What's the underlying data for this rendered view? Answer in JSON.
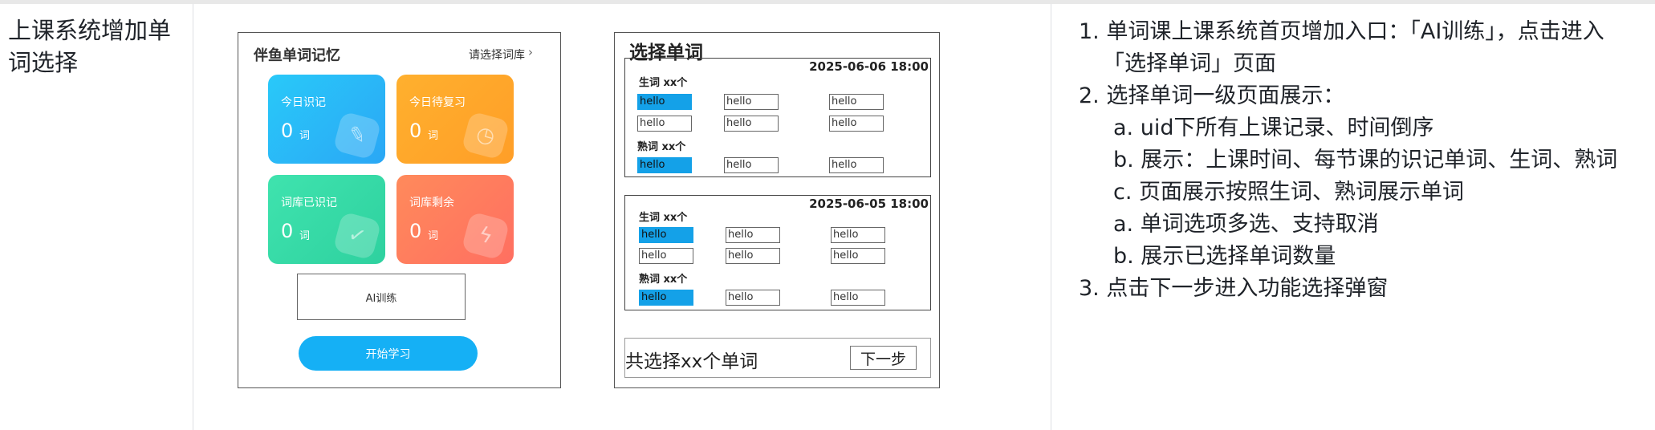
{
  "row_title": "上课系统增加单词选择",
  "mock_home": {
    "title": "伴鱼单词记忆",
    "select_lib": "请选择词库",
    "chevron": "›",
    "cards": [
      {
        "label": "今日识记",
        "value": "0",
        "unit": "词",
        "icon": "pencil-icon",
        "glyph": "✎"
      },
      {
        "label": "今日待复习",
        "value": "0",
        "unit": "词",
        "icon": "clock-icon",
        "glyph": "◷"
      },
      {
        "label": "词库已识记",
        "value": "0",
        "unit": "词",
        "icon": "check-icon",
        "glyph": "✓"
      },
      {
        "label": "词库剩余",
        "value": "0",
        "unit": "词",
        "icon": "bolt-icon",
        "glyph": "ϟ"
      }
    ],
    "ai_button": "AI训练",
    "start_button": "开始学习"
  },
  "mock_select": {
    "title": "选择单词",
    "groups": [
      {
        "date": "2025-06-06  18:00",
        "new_label": "生词  xx个",
        "known_label": "熟词  xx个",
        "new_rows": [
          [
            "hello",
            "hello",
            "hello"
          ],
          [
            "hello",
            "hello",
            "hello"
          ]
        ],
        "known_rows": [
          [
            "hello",
            "hello",
            "hello"
          ]
        ]
      },
      {
        "date": "2025-06-05  18:00",
        "new_label": "生词  xx个",
        "known_label": "熟词  xx个",
        "new_rows": [
          [
            "hello",
            "hello",
            "hello"
          ],
          [
            "hello",
            "hello",
            "hello"
          ]
        ],
        "known_rows": [
          [
            "hello",
            "hello",
            "hello"
          ]
        ]
      }
    ],
    "footer_text": "共选择xx个单词",
    "next_button": "下一步"
  },
  "description": [
    "1. 单词课上课系统首页增加入口：「AI训练」，点击进入",
    "「选择单词」页面",
    "2. 选择单词一级页面展示：",
    "a. uid下所有上课记录、时间倒序",
    "b. 展示：上课时间、每节课的识记单词、生词、熟词",
    "c. 页面展示按照生词、熟词展示单词",
    "a. 单词选项多选、支持取消",
    "b. 展示已选择单词数量",
    "3. 点击下一步进入功能选择弹窗"
  ],
  "colors": {
    "accent_blue": "#15b0f5",
    "selected_chip": "#14a1e8"
  }
}
